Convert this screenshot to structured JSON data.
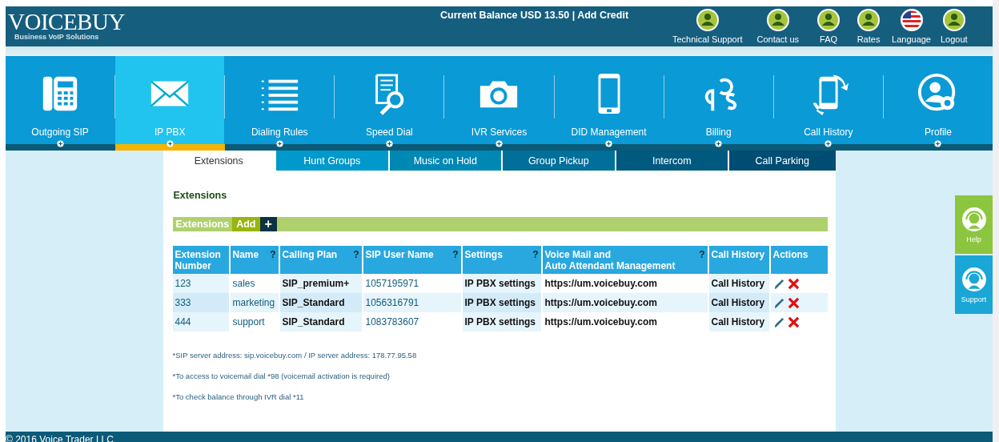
{
  "header": {
    "logo": "VOICEBUY",
    "tagline": "Business VoIP Solutions",
    "balance": "Current Balance USD 13.50 | Add Credit",
    "links": [
      {
        "label": "Technical Support",
        "kind": "user"
      },
      {
        "label": "Contact us",
        "kind": "user"
      },
      {
        "label": "FAQ",
        "kind": "user"
      },
      {
        "label": "Rates",
        "kind": "user"
      },
      {
        "label": "Language",
        "kind": "flag"
      },
      {
        "label": "Logout",
        "kind": "user"
      }
    ]
  },
  "nav": [
    {
      "label": "Outgoing SIP",
      "selected": false
    },
    {
      "label": "IP PBX",
      "selected": true
    },
    {
      "label": "Dialing Rules",
      "selected": false
    },
    {
      "label": "Speed Dial",
      "selected": false
    },
    {
      "label": "IVR Services",
      "selected": false
    },
    {
      "label": "DID Management",
      "selected": false
    },
    {
      "label": "Billing",
      "selected": false
    },
    {
      "label": "Call History",
      "selected": false
    },
    {
      "label": "Profile",
      "selected": false
    }
  ],
  "tabs": [
    {
      "label": "Extensions",
      "selected": true
    },
    {
      "label": "Hunt Groups",
      "selected": false
    },
    {
      "label": "Music on Hold",
      "selected": false
    },
    {
      "label": "Group Pickup",
      "selected": false
    },
    {
      "label": "Intercom",
      "selected": false
    },
    {
      "label": "Call Parking",
      "selected": false
    }
  ],
  "section_title": "Extensions",
  "toolbar": {
    "label": "Extensions",
    "add": "Add",
    "plus": "+"
  },
  "table": {
    "columns": [
      {
        "label": "Extension Number"
      },
      {
        "label": "Name",
        "help": "?"
      },
      {
        "label": "Calling Plan",
        "help": "?"
      },
      {
        "label": "SIP User Name",
        "help": "?"
      },
      {
        "label": "Settings",
        "help": "?"
      },
      {
        "label": "Voice Mail and\nAuto Attendant Management",
        "help": "?"
      },
      {
        "label": "Call History"
      },
      {
        "label": "Actions"
      }
    ],
    "rows": [
      {
        "number": "123",
        "name": "sales",
        "plan": "SIP_premium+",
        "sip_user": "1057195971",
        "settings": "IP PBX settings",
        "voicemail": "https://um.voicebuy.com",
        "history": "Call History"
      },
      {
        "number": "333",
        "name": "marketing",
        "plan": "SIP_Standard",
        "sip_user": "1056316791",
        "settings": "IP PBX settings",
        "voicemail": "https://um.voicebuy.com",
        "history": "Call History"
      },
      {
        "number": "444",
        "name": "support",
        "plan": "SIP_Standard",
        "sip_user": "1083783607",
        "settings": "IP PBX settings",
        "voicemail": "https://um.voicebuy.com",
        "history": "Call History"
      }
    ]
  },
  "notes": [
    "*SIP server address: sip.voicebuy.com / IP server address: 178.77.95.58",
    "*To access to voicemail dial *98  (voicemail activation is required)",
    "*To check balance through IVR dial *11"
  ],
  "side_widgets": [
    {
      "label": "Help",
      "selected": false
    },
    {
      "label": "Support",
      "selected": false
    }
  ],
  "footer": "© 2016 Voice Trader LLC"
}
